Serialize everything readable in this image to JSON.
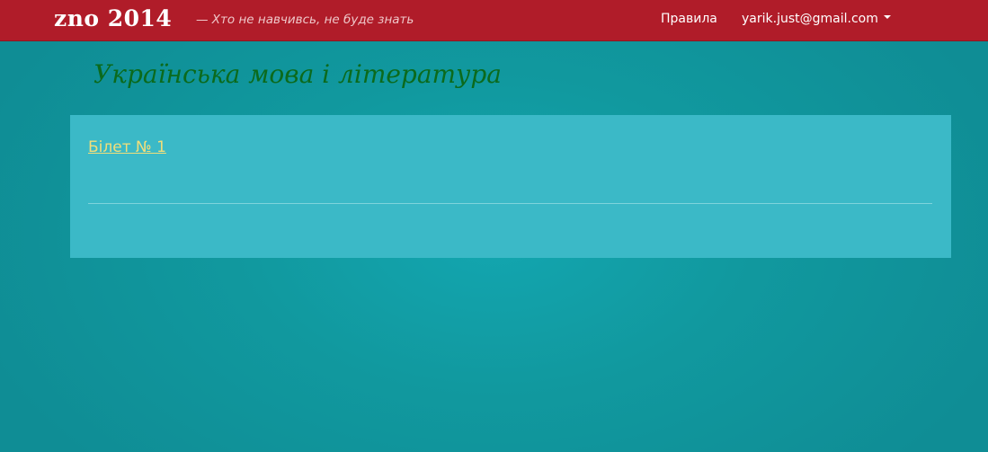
{
  "navbar": {
    "brand": "zno 2014",
    "tagline": "— Хто не навчивсь, не буде знать",
    "links": {
      "rules": "Правила",
      "user": "yarik.just@gmail.com"
    }
  },
  "main": {
    "title": "Українська мова і література",
    "tickets": [
      {
        "label": "Білет № 1"
      }
    ]
  },
  "colors": {
    "navbar_bg": "#b01c29",
    "page_bg": "#11999f",
    "panel_bg": "#3bb9c7",
    "title": "#0b6a1c",
    "link": "#f1de7a"
  }
}
